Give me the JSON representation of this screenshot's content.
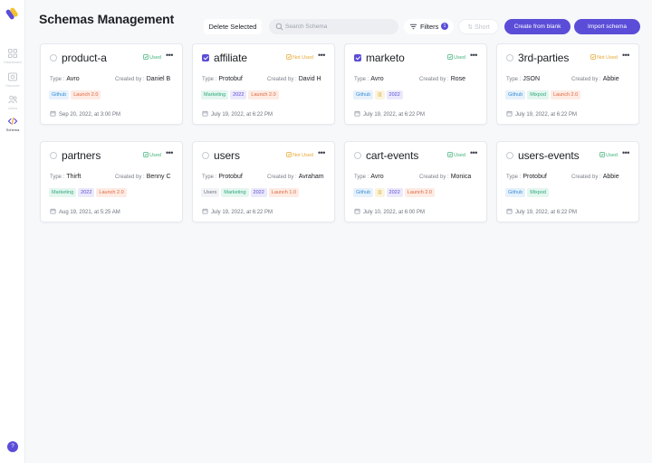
{
  "colors": {
    "accent": "#5b4dd8",
    "used": "#3fb37a",
    "not_used": "#e6a935"
  },
  "sidebar": {
    "items": [
      {
        "label": "Dashboard",
        "icon": "grid-icon",
        "active": false
      },
      {
        "label": "Discover",
        "icon": "compass-icon",
        "active": false
      },
      {
        "label": "Users",
        "icon": "users-icon",
        "active": false
      },
      {
        "label": "Schema",
        "icon": "code-icon",
        "active": true
      }
    ],
    "avatar": "?"
  },
  "header": {
    "title": "Schemas Management",
    "delete_label": "Delete Selected",
    "search_placeholder": "Search Schema",
    "filters_label": "Filters",
    "filters_count": "1",
    "sort_label": "Short",
    "create_label": "Create from blank",
    "import_label": "Import schema"
  },
  "labels": {
    "type": "Type :",
    "created_by": "Created by :"
  },
  "cards": [
    {
      "name": "product-a",
      "checked": false,
      "status": "Used",
      "type": "Avro",
      "created_by": "Daniel B",
      "tags": [
        {
          "text": "Github",
          "color": "blue"
        },
        {
          "text": "Launch 2.0",
          "color": "orange"
        }
      ],
      "date": "Sep 20, 2022, at 3:00 PM"
    },
    {
      "name": "affiliate",
      "checked": true,
      "status": "Not Used",
      "type": "Protobuf",
      "created_by": "David H",
      "tags": [
        {
          "text": "Marketing",
          "color": "green"
        },
        {
          "text": "2022",
          "color": "purple"
        },
        {
          "text": "Launch 2.0",
          "color": "orange"
        }
      ],
      "date": "July 19, 2022, at 6:22 PM"
    },
    {
      "name": "marketo",
      "checked": true,
      "status": "Used",
      "type": "Avro",
      "created_by": "Rose",
      "tags": [
        {
          "text": "Github",
          "color": "blue"
        },
        {
          "text": "|||",
          "color": "yellow"
        },
        {
          "text": "2022",
          "color": "purple"
        }
      ],
      "date": "July 19, 2022, at 6:22 PM"
    },
    {
      "name": "3rd-parties",
      "checked": false,
      "status": "Not Used",
      "type": "JSON",
      "created_by": "Abbie",
      "tags": [
        {
          "text": "Github",
          "color": "blue"
        },
        {
          "text": "Mixpod",
          "color": "green"
        },
        {
          "text": "Launch 2.0",
          "color": "orange"
        }
      ],
      "date": "July 19, 2022, at 6:22 PM"
    },
    {
      "name": "partners",
      "checked": false,
      "status": "Used",
      "type": "Thirft",
      "created_by": "Benny C",
      "tags": [
        {
          "text": "Marketing",
          "color": "green"
        },
        {
          "text": "2022",
          "color": "purple"
        },
        {
          "text": "Launch 2.0",
          "color": "orange"
        }
      ],
      "date": "Aug 19, 2021, at 5:25 AM"
    },
    {
      "name": "users",
      "checked": false,
      "status": "Not Used",
      "type": "Protobuf",
      "created_by": "Avraham",
      "tags": [
        {
          "text": "Users",
          "color": "plain"
        },
        {
          "text": "Marketing",
          "color": "green"
        },
        {
          "text": "2022",
          "color": "purple"
        },
        {
          "text": "Launch 1.0",
          "color": "orange"
        }
      ],
      "date": "July 19, 2022, at 6:22 PM"
    },
    {
      "name": "cart-events",
      "checked": false,
      "status": "Used",
      "type": "Avro",
      "created_by": "Monica",
      "tags": [
        {
          "text": "Github",
          "color": "blue"
        },
        {
          "text": "|||",
          "color": "yellow"
        },
        {
          "text": "2022",
          "color": "purple"
        },
        {
          "text": "Launch 2.0",
          "color": "orange"
        }
      ],
      "date": "July 10, 2022, at 6:00 PM"
    },
    {
      "name": "users-events",
      "checked": false,
      "status": "Used",
      "type": "Protobuf",
      "created_by": "Abbie",
      "tags": [
        {
          "text": "Github",
          "color": "blue"
        },
        {
          "text": "Mixpod",
          "color": "green"
        }
      ],
      "date": "July 19, 2022, at 6:22 PM"
    }
  ]
}
